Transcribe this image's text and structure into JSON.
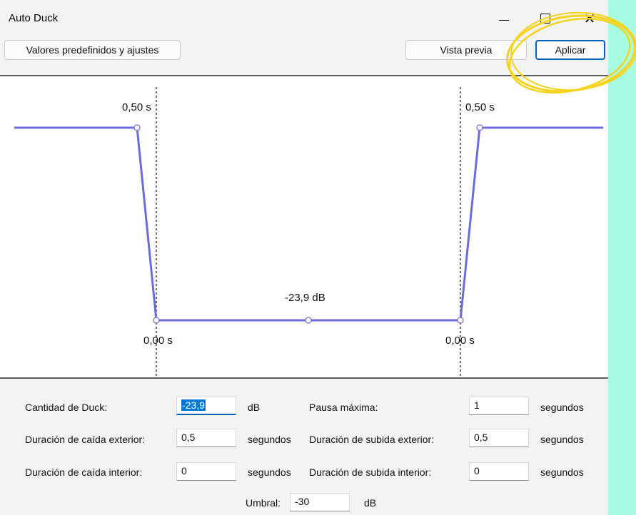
{
  "window": {
    "title": "Auto Duck",
    "controls": [
      "minimize-icon",
      "maximize-icon",
      "close-icon"
    ]
  },
  "toolbar": {
    "presets_label": "Valores predefinidos y ajustes",
    "preview_label": "Vista previa",
    "apply_label": "Aplicar"
  },
  "graph": {
    "outer_fade_left_label": "0,50 s",
    "outer_fade_right_label": "0,50 s",
    "inner_fade_left_label": "0,00 s",
    "inner_fade_right_label": "0,00 s",
    "duck_amount_label": "-23,9 dB",
    "line_color": "#6b6bdc"
  },
  "form": {
    "duck_amount": {
      "label": "Cantidad de Duck:",
      "value": "-23,9",
      "unit": "dB"
    },
    "max_pause": {
      "label": "Pausa máxima:",
      "value": "1",
      "unit": "segundos"
    },
    "outer_fade_down": {
      "label": "Duración de caída exterior:",
      "value": "0,5",
      "unit": "segundos"
    },
    "outer_fade_up": {
      "label": "Duración de subida exterior:",
      "value": "0,5",
      "unit": "segundos"
    },
    "inner_fade_down": {
      "label": "Duración de caída interior:",
      "value": "0",
      "unit": "segundos"
    },
    "inner_fade_up": {
      "label": "Duración de subida interior:",
      "value": "0",
      "unit": "segundos"
    },
    "threshold": {
      "label": "Umbral:",
      "value": "-30",
      "unit": "dB"
    }
  },
  "annotation": {
    "color": "#f5d31b"
  }
}
